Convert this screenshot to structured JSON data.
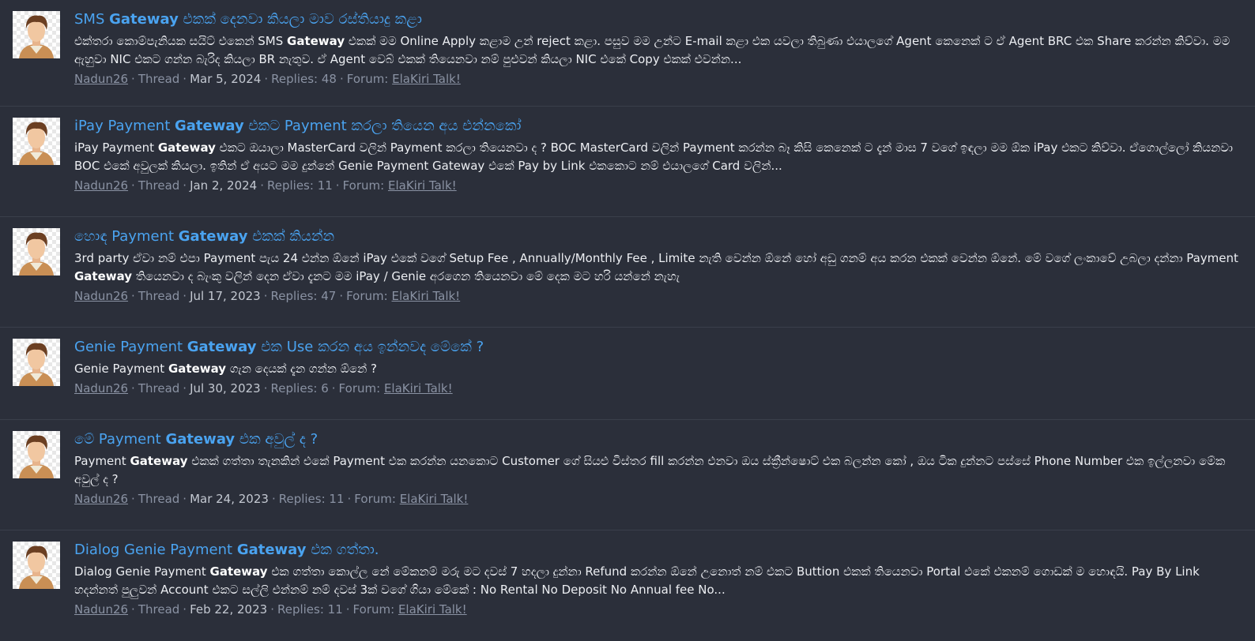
{
  "results": [
    {
      "title_pre": "SMS ",
      "title_bold": "Gateway",
      "title_post": " එකක් දෙනවා කියලා මාව රස්තියාදු කළා",
      "snippet_pre": "එක්තරා කොම්පැනියක සයිට් එකෙන් SMS ",
      "snippet_bold": "Gateway",
      "snippet_post": " එකක් මම Online Apply කළාම උන් reject කළා. පසුව මම උන්ට E-mail කළා එක යවලා තිබුණා එයාලගේ Agent කෙනෙක් ට ඒ Agent BRC එක Share කරන්න කිව්වා. මම ඇහුවා NIC එකට ගන්න බැරිද කියලා BR නැතුව. ඒ Agent වෙබ් එකක් තියෙනවා නම් පුළුවන් කියලා NIC එකේ Copy එකක් එවන්න...",
      "author": "Nadun26",
      "type": "Thread",
      "date": "Mar 5, 2024",
      "replies": "Replies: 48",
      "forum_label": "Forum:",
      "forum": "ElaKiri Talk!"
    },
    {
      "title_pre": "iPay Payment ",
      "title_bold": "Gateway",
      "title_post": " එකට Payment කරලා තියෙන අය එන්නකෝ",
      "snippet_pre": "iPay Payment ",
      "snippet_bold": "Gateway",
      "snippet_post": " එකට ඔයාලා MasterCard වලින් Payment කරලා තියෙනවා ද ? BOC MasterCard වලින් Payment කරන්න බෑ කිසි කෙනෙක් ට දැන් මාස 7 වගේ ඉඳලා මම ඕක iPay එකට කිව්වා. ඒගොල්ලෝ කියනවා BOC එකේ අවුලක් කියලා. ඉතින් ඒ අයට මම දුන්නේ Genie Payment Gateway එකේ Pay by Link එකකොට නම් එයාලගේ Card වලින්...",
      "author": "Nadun26",
      "type": "Thread",
      "date": "Jan 2, 2024",
      "replies": "Replies: 11",
      "forum_label": "Forum:",
      "forum": "ElaKiri Talk!"
    },
    {
      "title_pre": "හොඳ Payment ",
      "title_bold": "Gateway",
      "title_post": " එකක් කියන්න",
      "snippet_pre": "3rd party ඒවා නම් එපා Payment පැය 24 එන්න ඕනේ iPay එකේ වගේ Setup Fee , Annually/Monthly Fee , Limite නැති වෙන්න ඕනේ හෝ අඩු ගනම් අය කරන එකක් වෙන්න ඕනේ. මේ වගේ ලංකාවේ උබලා දන්නා Payment ",
      "snippet_bold": "Gateway",
      "snippet_post": " තියෙනවා ද බැංකු වලින් දෙන ඒවා දැනට මම iPay / Genie අරගෙන තියෙනවා මේ දෙක මට හරි යන්නේ නැහැ",
      "author": "Nadun26",
      "type": "Thread",
      "date": "Jul 17, 2023",
      "replies": "Replies: 47",
      "forum_label": "Forum:",
      "forum": "ElaKiri Talk!"
    },
    {
      "title_pre": "Genie Payment ",
      "title_bold": "Gateway",
      "title_post": " එක Use කරන අය ඉන්නවද මේකේ ?",
      "snippet_pre": "Genie Payment ",
      "snippet_bold": "Gateway",
      "snippet_post": " ගැන දෙයක් දැන ගන්න ඕනේ ?",
      "author": "Nadun26",
      "type": "Thread",
      "date": "Jul 30, 2023",
      "replies": "Replies: 6",
      "forum_label": "Forum:",
      "forum": "ElaKiri Talk!"
    },
    {
      "title_pre": "මේ Payment ",
      "title_bold": "Gateway",
      "title_post": " එක අවුල් ද ?",
      "snippet_pre": "Payment ",
      "snippet_bold": "Gateway",
      "snippet_post": " එකක් ගත්තා තැනකින් එකේ Payment එක කරන්න යනකොට Customer ගේ සියළු විස්තර fill කරන්න එනවා ඔය ස්ක්‍රීන්ෂොට් එක බලන්න කෝ , ඔය ටික දුන්නට පස්සේ Phone Number එක ඉල්ලනවා මේක අවුල් ද ?",
      "author": "Nadun26",
      "type": "Thread",
      "date": "Mar 24, 2023",
      "replies": "Replies: 11",
      "forum_label": "Forum:",
      "forum": "ElaKiri Talk!"
    },
    {
      "title_pre": "Dialog Genie Payment ",
      "title_bold": "Gateway",
      "title_post": " එක ගත්තා.",
      "snippet_pre": "Dialog Genie Payment ",
      "snippet_bold": "Gateway",
      "snippet_post": " එක ගත්තා කොල්ල නේ මේකනම් මරු මට දවස් 7 හදලා දුන්නා Refund කරන්න ඕනේ උනොත් නම් එකට Buttion එකක් තියෙනවා Portal එකේ එකනම් ගොඩක් ම හොඳයි. Pay By Link හදන්නත් පුලුවන් Account එකට සල්ලි එන්නම් නම් දවස් 3ක් වගේ ගියා මේකේ : No Rental No Deposit No Annual fee No...",
      "author": "Nadun26",
      "type": "Thread",
      "date": "Feb 22, 2023",
      "replies": "Replies: 11",
      "forum_label": "Forum:",
      "forum": "ElaKiri Talk!"
    }
  ],
  "colors": {
    "background": "#2b2f3a",
    "title": "#4aa3f0",
    "meta": "#8a92a3",
    "divider": "#3a3f4b"
  },
  "icons": {
    "avatar": "default-avatar-icon"
  }
}
